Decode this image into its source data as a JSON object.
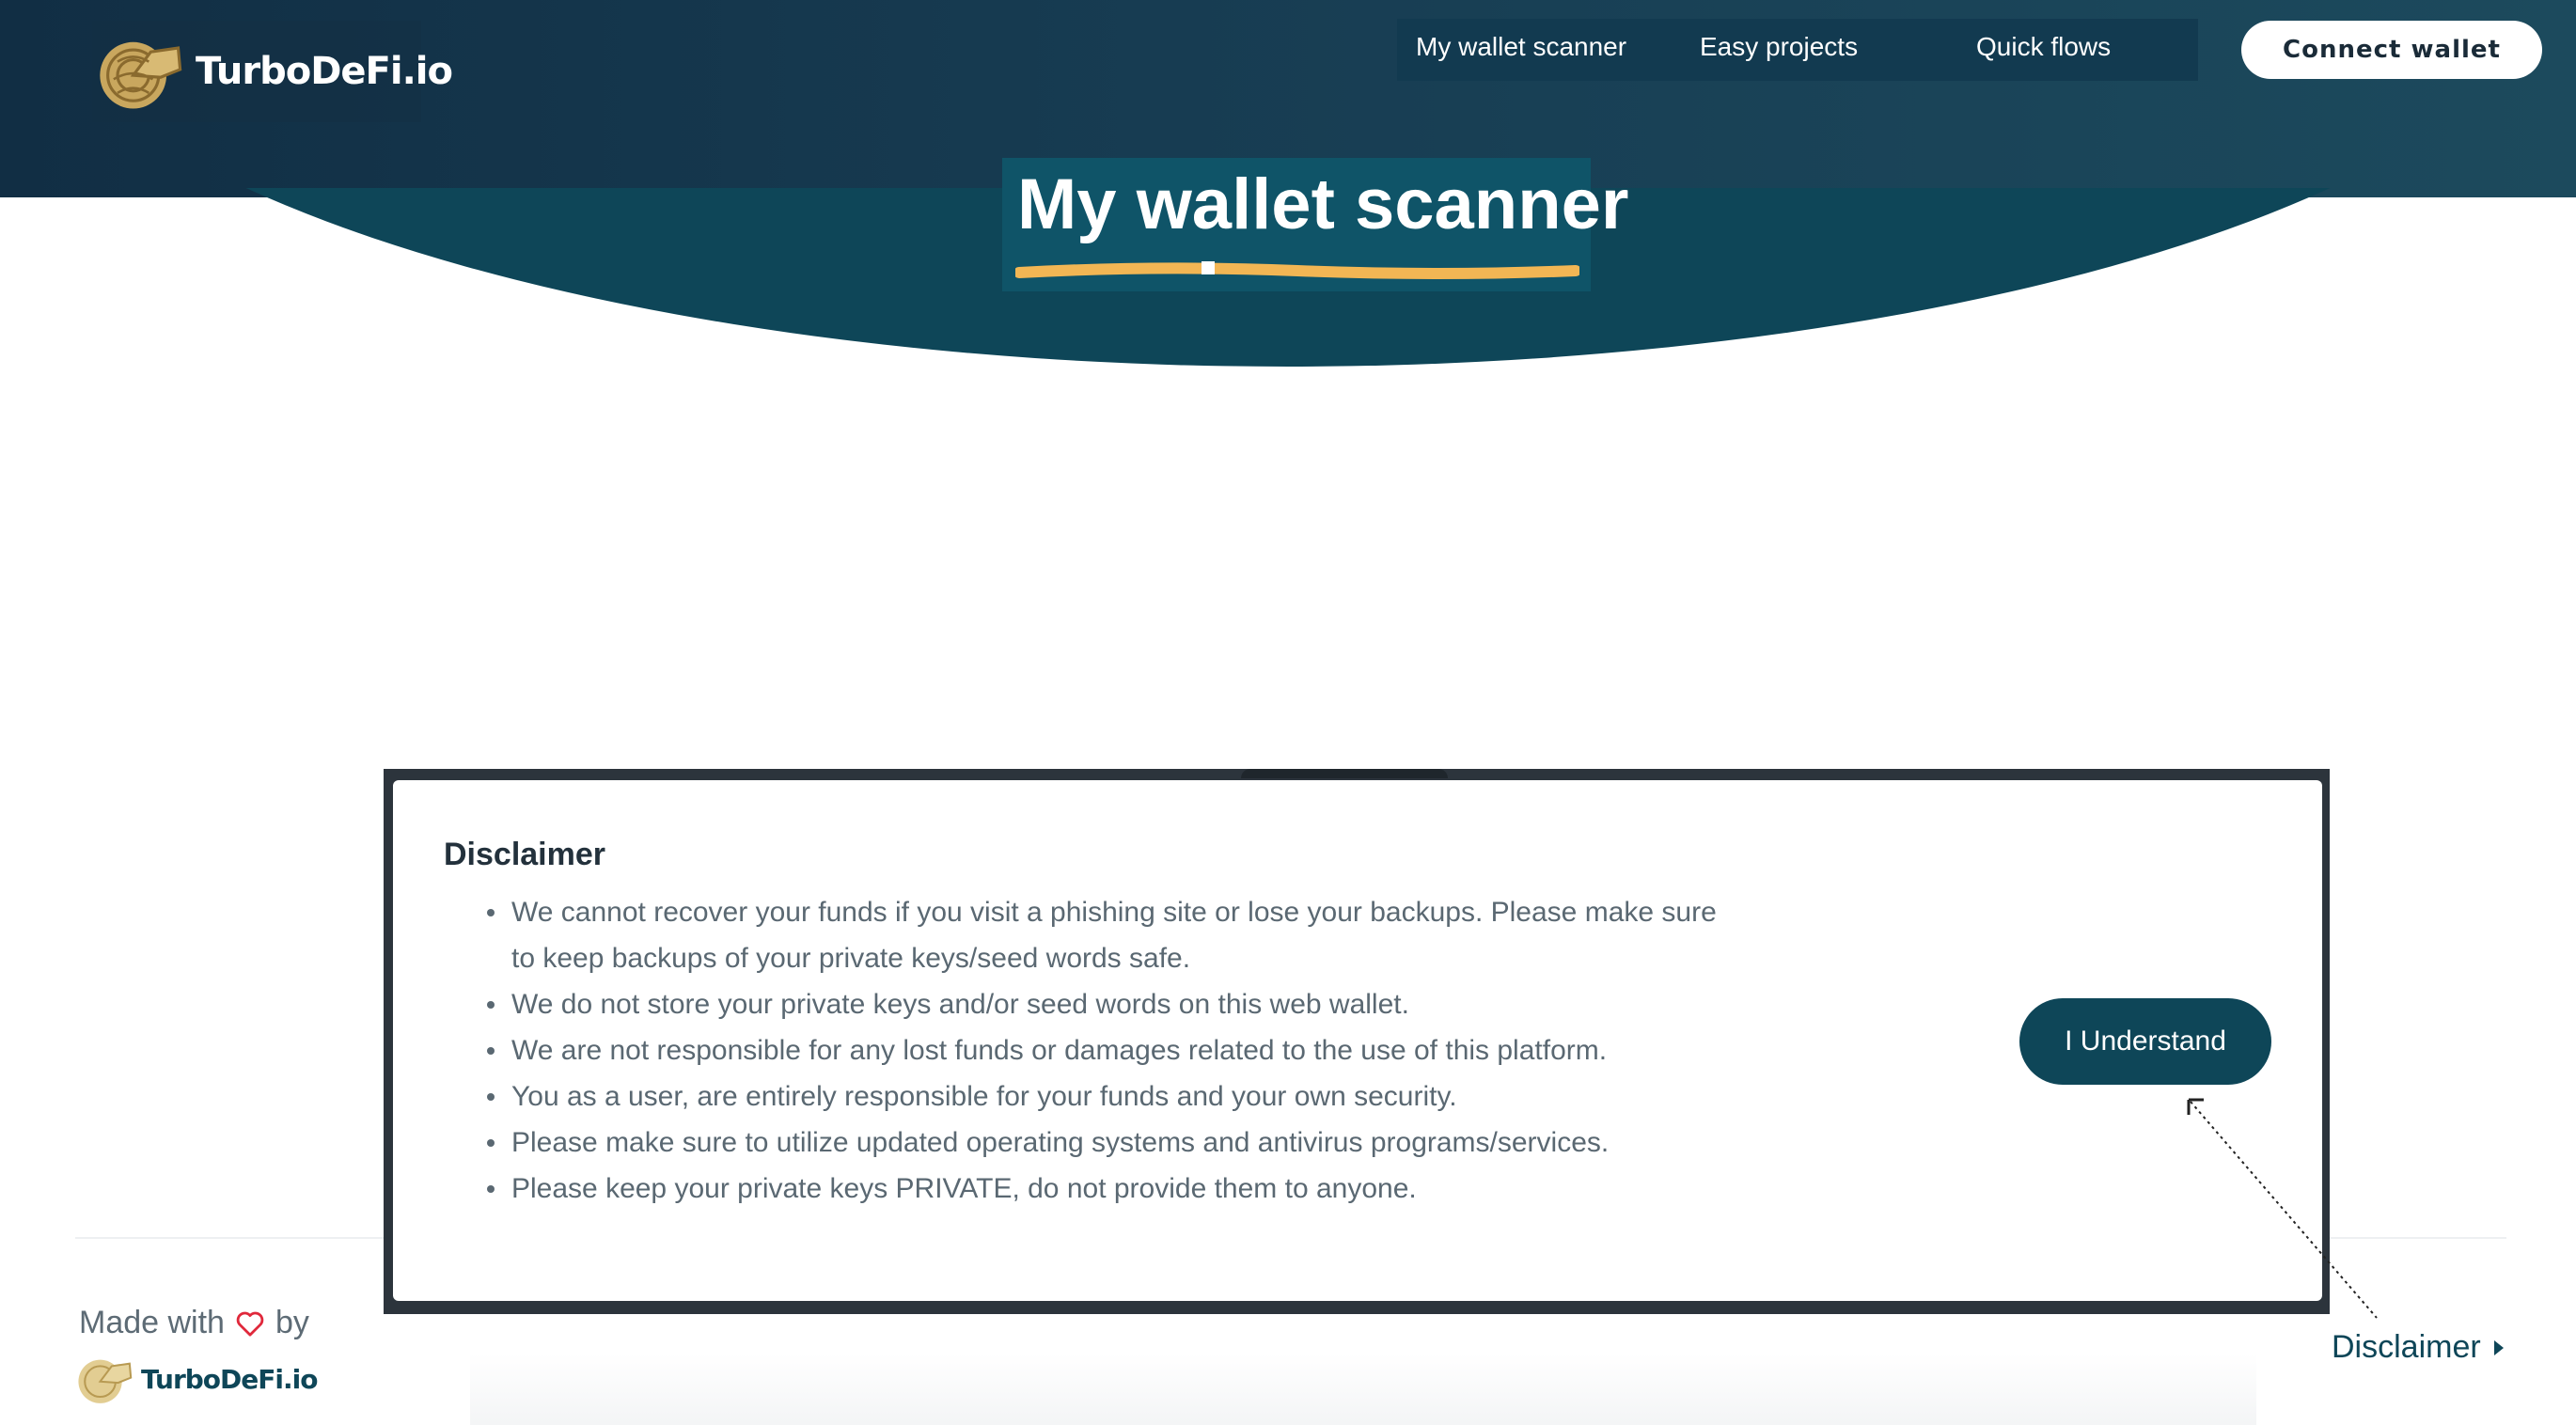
{
  "header": {
    "logo_text": "TurboDeFi.io",
    "nav": [
      {
        "label": "My wallet scanner"
      },
      {
        "label": "Easy projects"
      },
      {
        "label": "Quick flows"
      }
    ],
    "connect_label": "Connect wallet"
  },
  "hero": {
    "title": "My wallet scanner"
  },
  "modal": {
    "title": "Disclaimer",
    "items": [
      "We cannot recover your funds if you visit a phishing site or lose your backups. Please make sure to keep backups of your private keys/seed words safe.",
      "We do not store your private keys and/or seed words on this web wallet.",
      "We are not responsible for any lost funds or damages related to the use of this platform.",
      "You as a user, are entirely responsible for your funds and your own security.",
      "Please make sure to utilize updated operating systems and antivirus programs/services.",
      "Please keep your private keys PRIVATE, do not provide them to anyone."
    ],
    "button_label": "I Understand"
  },
  "footer": {
    "made_with": "Made with",
    "by": "by",
    "logo_text": "TurboDeFi.io",
    "disclaimer_label": "Disclaimer"
  },
  "colors": {
    "brand_dark": "#0e4658",
    "header_gradient_start": "#112e44",
    "accent_underline": "#f2b654",
    "heart": "#e0283b",
    "text_muted": "#5a6872"
  },
  "icons": [
    "turbo-logo-icon",
    "heart-icon",
    "caret-right-icon"
  ]
}
